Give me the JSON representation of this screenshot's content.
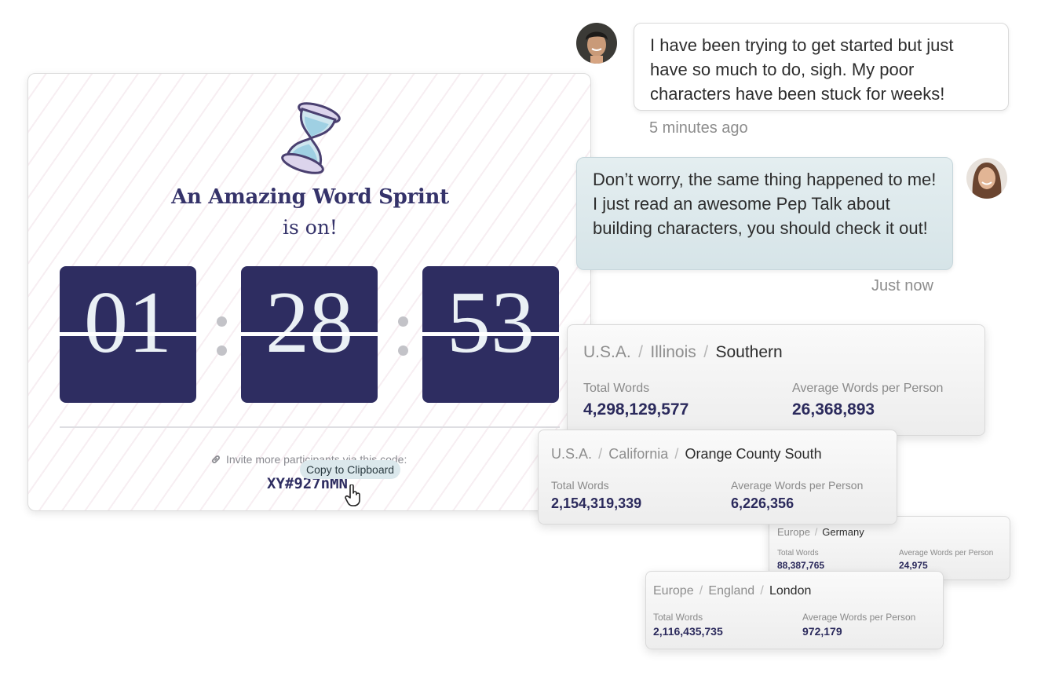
{
  "sprint": {
    "title": "An Amazing Word Sprint",
    "subtitle": "is on!",
    "timer": {
      "hours": "01",
      "minutes": "28",
      "seconds": "53"
    },
    "invite_text": "Invite more participants via this code:",
    "tooltip": "Copy to Clipboard",
    "code": "XY#927nMN",
    "colors": {
      "timer_bg": "#2e2d61",
      "title": "#35336a"
    }
  },
  "chat": {
    "message_1": {
      "text": "I have been trying to get started but just have so much to do, sigh. My poor characters have been stuck for weeks!",
      "time": "5 minutes ago"
    },
    "message_2": {
      "text": "Don’t worry, the same thing happened to me! I just read an awesome Pep Talk about building characters, you should check it out!",
      "time": "Just now"
    }
  },
  "stats": {
    "separator": "/",
    "total_label": "Total Words",
    "avg_label": "Average Words per Person",
    "cards": [
      {
        "crumbs": [
          "U.S.A.",
          "Illinois"
        ],
        "current": "Southern",
        "total": "4,298,129,577",
        "avg": "26,368,893"
      },
      {
        "crumbs": [
          "U.S.A.",
          "California"
        ],
        "current": "Orange County South",
        "total": "2,154,319,339",
        "avg": "6,226,356"
      },
      {
        "crumbs": [
          "Europe"
        ],
        "current": "Germany",
        "total": "88,387,765",
        "avg": "24,975"
      },
      {
        "crumbs": [
          "Europe",
          "England"
        ],
        "current": "London",
        "total": "2,116,435,735",
        "avg": "972,179"
      }
    ]
  }
}
